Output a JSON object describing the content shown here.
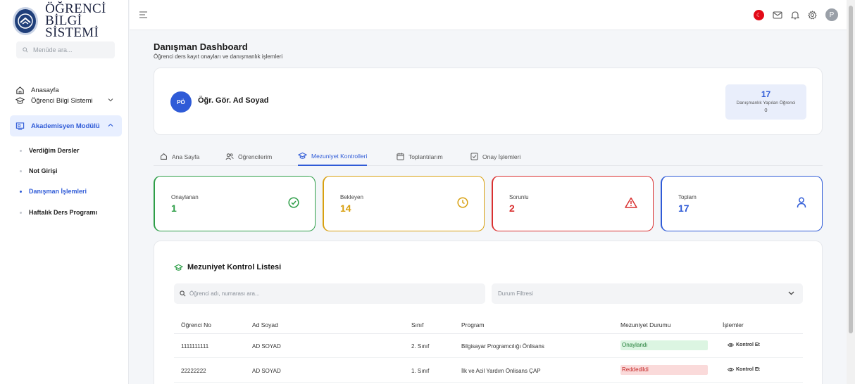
{
  "app": {
    "logo_line1": "ÖĞRENCİ",
    "logo_line2": "BİLGİ SİSTEMİ"
  },
  "sidebar": {
    "search_placeholder": "Menüde ara...",
    "items": [
      {
        "label": "Anasayfa"
      },
      {
        "label": "Öğrenci Bilgi Sistemi"
      },
      {
        "label": "Akademisyen Modülü"
      }
    ],
    "subitems": [
      {
        "label": "Verdiğim Dersler"
      },
      {
        "label": "Not Girişi"
      },
      {
        "label": "Danışman İşlemleri"
      },
      {
        "label": "Haftalık Ders Programı"
      }
    ]
  },
  "topbar": {
    "avatar_initial": "P",
    "flag_symbol": "☾"
  },
  "page": {
    "title": "Danışman Dashboard",
    "subtitle": "Öğrenci ders kayıt onayları ve danışmanlık işlemleri"
  },
  "profile": {
    "initials": "PÖ",
    "name": "Öğr. Gör. Ad Soyad",
    "stat_value": "17",
    "stat_label": "Danışmanlık Yapılan Öğrenci",
    "stat_sub": "0"
  },
  "tabs": [
    {
      "label": "Ana Sayfa"
    },
    {
      "label": "Öğrencilerim"
    },
    {
      "label": "Mezuniyet Kontrolleri"
    },
    {
      "label": "Toplantılarım"
    },
    {
      "label": "Onay İşlemleri"
    }
  ],
  "stats": [
    {
      "label": "Onaylanan",
      "value": "1",
      "color": "#2e9e48"
    },
    {
      "label": "Bekleyen",
      "value": "14",
      "color": "#d8a010"
    },
    {
      "label": "Sorunlu",
      "value": "2",
      "color": "#d93030"
    },
    {
      "label": "Toplam",
      "value": "17",
      "color": "#2f5bd7"
    }
  ],
  "list": {
    "title": "Mezuniyet Kontrol Listesi",
    "search_placeholder": "Öğrenci adı, numarası ara...",
    "filter_placeholder": "Durum Filtresi",
    "headers": [
      "Öğrenci No",
      "Ad Soyad",
      "Sınıf",
      "Program",
      "Mezuniyet Durumu",
      "İşlemler"
    ],
    "rows": [
      {
        "no": "1111111111",
        "name": "AD SOYAD",
        "class": "2. Sınıf",
        "program": "Bilgisayar Programcılığı Önlisans",
        "status": "Onaylandı",
        "action": "Kontrol Et"
      },
      {
        "no": "22222222",
        "name": "AD SOYAD",
        "class": "1. Sınıf",
        "program": "İlk ve Acil Yardım Önlisans ÇAP",
        "status": "Reddedildi",
        "action": "Kontrol Et"
      }
    ]
  }
}
